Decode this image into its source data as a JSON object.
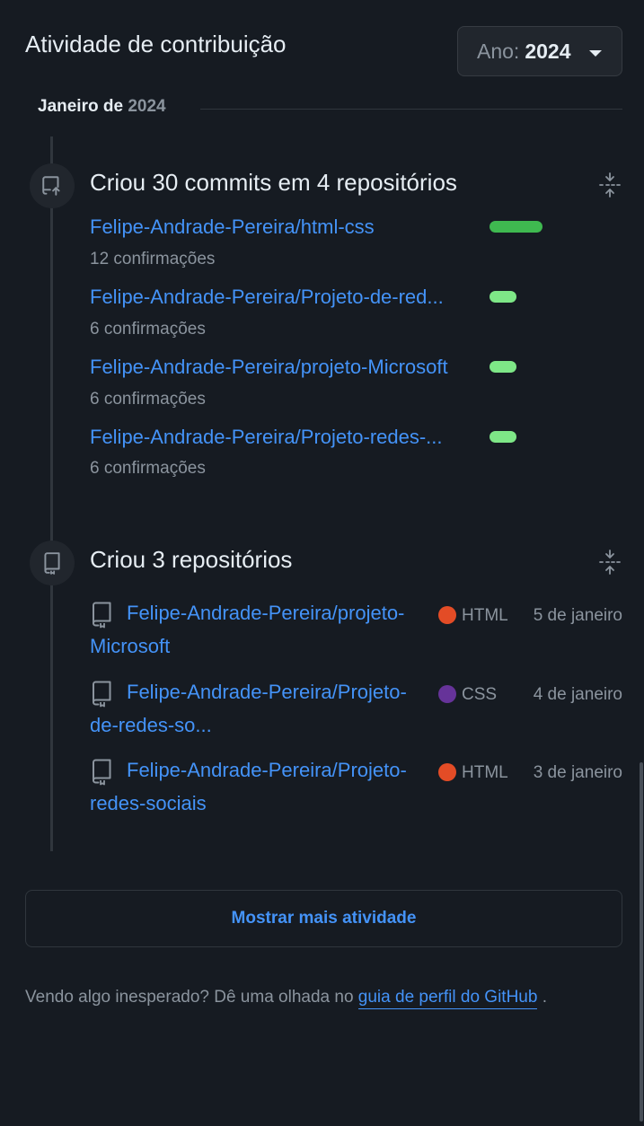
{
  "header": {
    "title": "Atividade de contribuição",
    "year_label": "Ano:",
    "year_value": "2024"
  },
  "month": {
    "name": "Janeiro de",
    "year": "2024"
  },
  "commits_group": {
    "title": "Criou 30 commits em 4 repositórios",
    "items": [
      {
        "repo": "Felipe-Andrade-Pereira/html-css",
        "count": "12 confirmações",
        "share": 1.0,
        "color": "#3fb950"
      },
      {
        "repo": "Felipe-Andrade-Pereira/Projeto-de-red...",
        "count": "6 confirmações",
        "share": 0.5,
        "color": "#7ee787"
      },
      {
        "repo": "Felipe-Andrade-Pereira/projeto-Microsoft",
        "count": "6 confirmações",
        "share": 0.5,
        "color": "#7ee787"
      },
      {
        "repo": "Felipe-Andrade-Pereira/Projeto-redes-...",
        "count": "6 confirmações",
        "share": 0.5,
        "color": "#7ee787"
      }
    ]
  },
  "repos_group": {
    "title": "Criou 3 repositórios",
    "items": [
      {
        "line1": "Felipe-Andrade-Pereira/projeto-",
        "line2": "Microsoft",
        "language": "HTML",
        "language_color": "#e34c26",
        "date": "5 de janeiro"
      },
      {
        "line1": "Felipe-Andrade-Pereira/Projeto-",
        "line2": "de-redes-so...",
        "language": "CSS",
        "language_color": "#663399",
        "date": "4 de janeiro"
      },
      {
        "line1": "Felipe-Andrade-Pereira/Projeto-",
        "line2": "redes-sociais",
        "language": "HTML",
        "language_color": "#e34c26",
        "date": "3 de janeiro"
      }
    ]
  },
  "show_more": "Mostrar mais atividade",
  "footnote": {
    "text": "Vendo algo inesperado? Dê uma olhada no",
    "link": "guia de perfil do GitHub",
    "end": "."
  },
  "icons": {
    "commits": "repo-push-icon",
    "repos": "repo-icon",
    "collapse": "fold-icon",
    "dropdown": "caret-down-icon"
  }
}
